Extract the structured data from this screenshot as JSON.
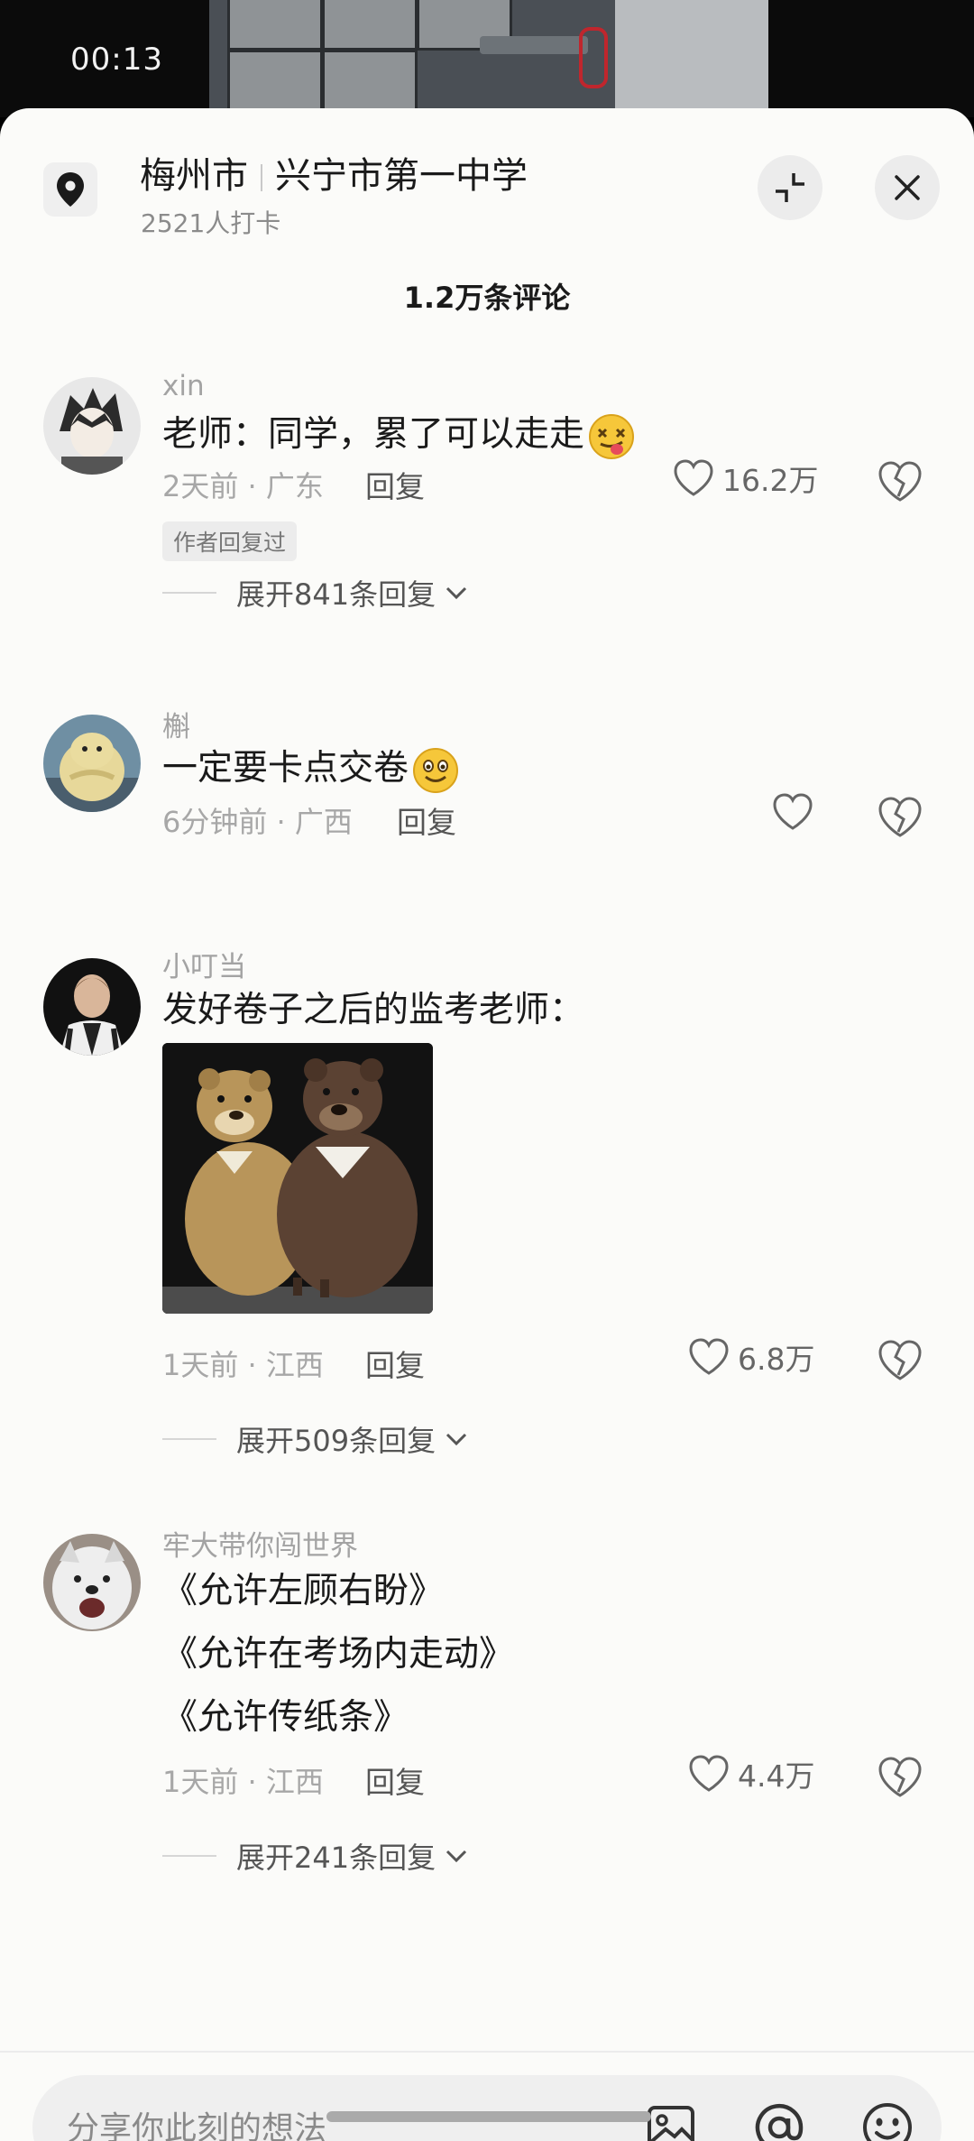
{
  "video": {
    "time": "00:13"
  },
  "location": {
    "city": "梅州市",
    "place": "兴宁市第一中学",
    "checkins": "2521人打卡"
  },
  "comments_header": {
    "count_label": "1.2万条评论"
  },
  "comments": [
    {
      "username": "xin",
      "text": "老师：同学，累了可以走走",
      "emoji": "dizzy-tongue-emoji",
      "time_location": "2天前 · 广东",
      "reply_label": "回复",
      "likes": "16.2万",
      "author_tag": "作者回复过",
      "expand_label": "展开841条回复"
    },
    {
      "username": "槲",
      "text": "一定要卡点交卷",
      "emoji": "smile-emoji",
      "time_location": "6分钟前 · 广西",
      "reply_label": "回复",
      "likes": ""
    },
    {
      "username": "小叮当",
      "text": "发好卷子之后的监考老师：",
      "image": "two-bears-image",
      "time_location": "1天前 · 江西",
      "reply_label": "回复",
      "likes": "6.8万",
      "expand_label": "展开509条回复"
    },
    {
      "username": "牢大带你闯世界",
      "lines": [
        "《允许左顾右盼》",
        "《允许在考场内走动》",
        "《允许传纸条》"
      ],
      "time_location": "1天前 · 江西",
      "reply_label": "回复",
      "likes": "4.4万",
      "expand_label": "展开241条回复"
    }
  ],
  "input": {
    "placeholder": "分享你此刻的想法"
  },
  "icons": {
    "location": "location-pin-icon",
    "collapse": "collapse-icon",
    "close": "close-icon",
    "like": "heart-outline-icon",
    "dislike": "broken-heart-icon",
    "expand": "chevron-down-icon",
    "image": "image-icon",
    "mention": "at-icon",
    "emoji": "emoji-face-icon"
  }
}
